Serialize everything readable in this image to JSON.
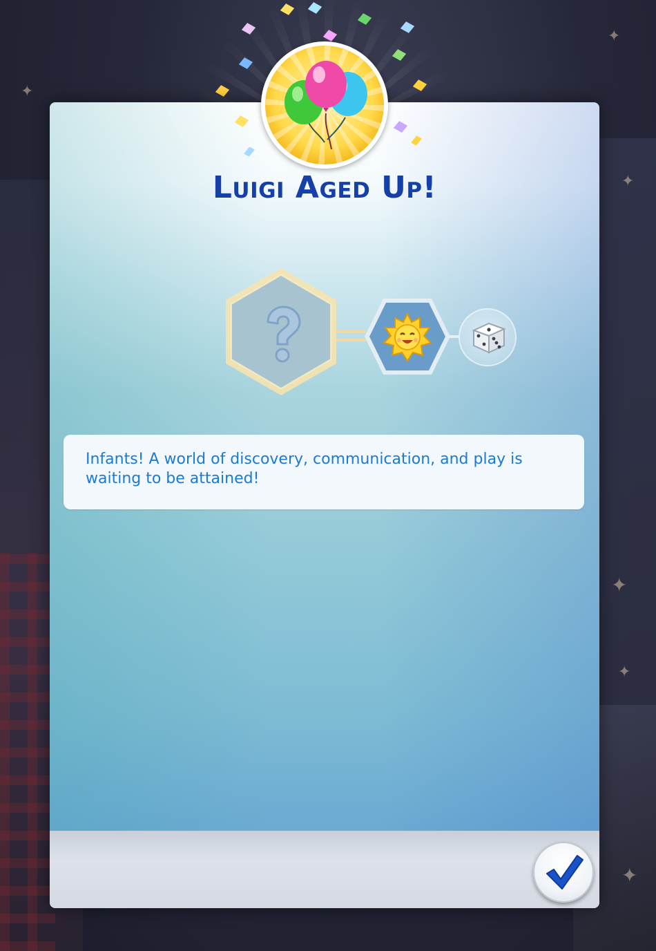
{
  "dialog": {
    "title": "Luigi Aged Up!",
    "description": "Infants! A world of discovery, communication, and play is waiting to be attained!",
    "header_icon": "balloons-icon",
    "lifestage_chain": {
      "aspiration_icon": "question-mark-icon",
      "trait_icon": "sun-face-icon",
      "bonus_icon": "dice-icon"
    },
    "confirm_button_icon": "checkmark-icon"
  },
  "colors": {
    "title": "#1540a8",
    "description_text": "#1b7ad4",
    "checkmark": "#1a52c8"
  }
}
